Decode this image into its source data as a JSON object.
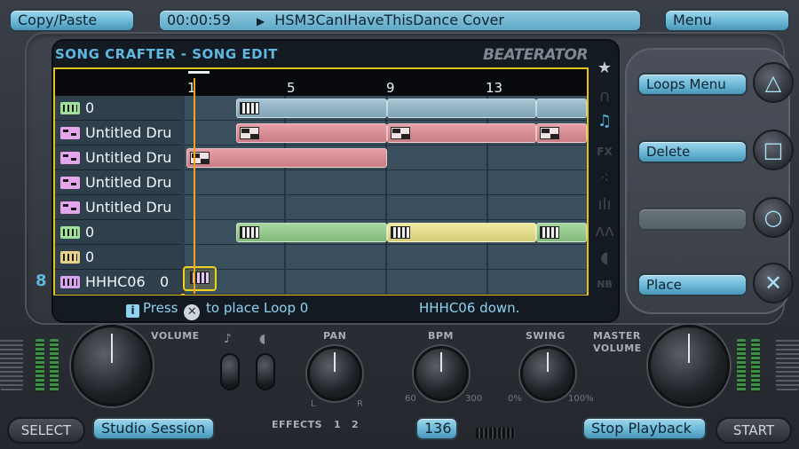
{
  "top_bar": {
    "copy_paste": "Copy/Paste",
    "time": "00:00:59",
    "song_name": "HSM3CanIHaveThisDance Cover",
    "menu": "Menu"
  },
  "screen": {
    "title": "SONG CRAFTER - SONG EDIT",
    "brand": "BEATERATOR"
  },
  "ruler": {
    "marks": [
      "1",
      "5",
      "9",
      "13"
    ]
  },
  "tracks": [
    {
      "label": "0",
      "type": "synth"
    },
    {
      "label": "Untitled Dru",
      "type": "drum"
    },
    {
      "label": "Untitled Dru",
      "type": "drum"
    },
    {
      "label": "Untitled Dru",
      "type": "drum"
    },
    {
      "label": "Untitled Dru",
      "type": "drum"
    },
    {
      "label": "0",
      "type": "synth"
    },
    {
      "label": "0",
      "type": "bass"
    },
    {
      "label": "HHHC06",
      "value": "0",
      "type": "sample"
    }
  ],
  "status": {
    "hint_prefix": "Press",
    "hint_suffix": "to place Loop 0",
    "message": "HHHC06 down."
  },
  "right_buttons": {
    "loops_menu": "Loops Menu",
    "delete": "Delete",
    "empty": "",
    "place": "Place"
  },
  "track_number": "8",
  "controls": {
    "volume": "VOLUME",
    "pan": "PAN",
    "pan_l": "L",
    "pan_r": "R",
    "bpm": "BPM",
    "bpm_min": "60",
    "bpm_max": "300",
    "swing": "SWING",
    "swing_min": "0%",
    "swing_max": "100%",
    "master_volume_1": "MASTER",
    "master_volume_2": "VOLUME",
    "effects": "EFFECTS",
    "effect_1": "1",
    "effect_2": "2"
  },
  "bottom_bar": {
    "select": "SELECT",
    "studio_session": "Studio Session",
    "bpm_value": "136",
    "stop_playback": "Stop Playback",
    "start": "START"
  },
  "icons": [
    "star-icon",
    "headphones-icon",
    "music-note-icon",
    "fx-icon",
    "dots-icon",
    "wave-icon",
    "mountain-icon",
    "speaker-icon",
    "nb-icon"
  ]
}
